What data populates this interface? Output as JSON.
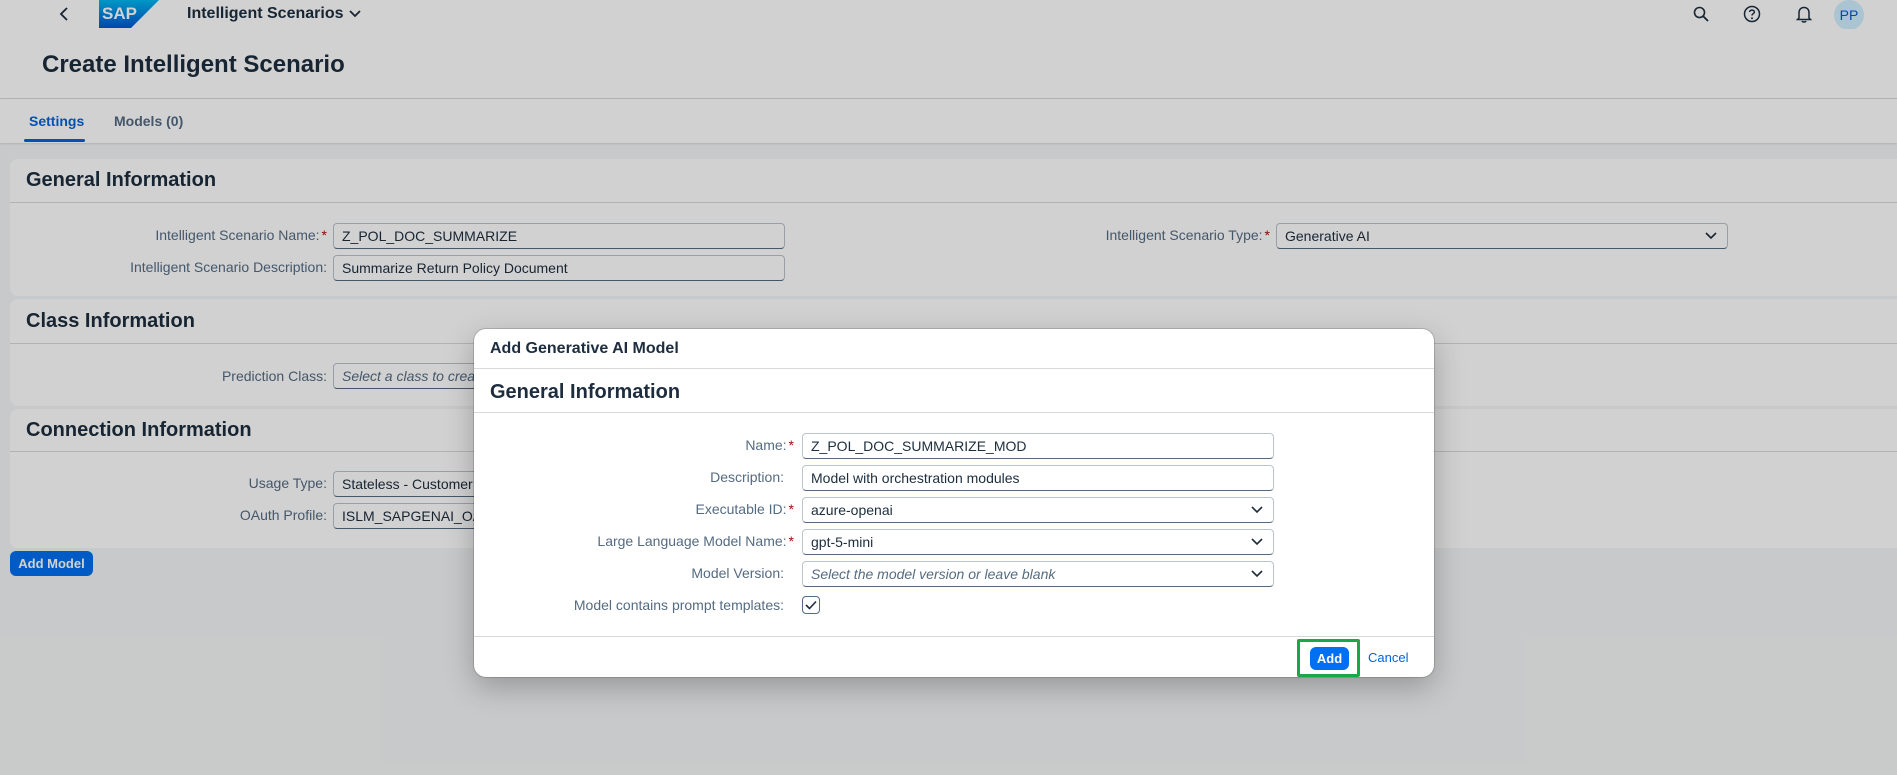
{
  "shell": {
    "logo_text": "SAP",
    "app_name": "Intelligent Scenarios",
    "avatar_initials": "PP"
  },
  "page": {
    "title": "Create Intelligent Scenario",
    "tabs": [
      {
        "label": "Settings"
      },
      {
        "label": "Models (0)"
      }
    ]
  },
  "general": {
    "heading": "General Information",
    "name_label": "Intelligent Scenario Name:",
    "name_value": "Z_POL_DOC_SUMMARIZE",
    "description_label": "Intelligent Scenario Description:",
    "description_value": "Summarize Return Policy Document",
    "type_label": "Intelligent Scenario Type:",
    "type_value": "Generative AI"
  },
  "class": {
    "heading": "Class Information",
    "prediction_label": "Prediction Class:",
    "prediction_placeholder": "Select a class to crea"
  },
  "connection": {
    "heading": "Connection Information",
    "usage_label": "Usage Type:",
    "usage_value": "Stateless - Customer",
    "oauth_label": "OAuth Profile:",
    "oauth_value": "ISLM_SAPGENAI_OA"
  },
  "add_model_label": "Add Model",
  "dialog": {
    "title": "Add Generative AI Model",
    "section": "General Information",
    "name_label": "Name:",
    "name_value": "Z_POL_DOC_SUMMARIZE_MOD",
    "description_label": "Description:",
    "description_value": "Model with orchestration modules",
    "exec_label": "Executable ID:",
    "exec_value": "azure-openai",
    "llm_label": "Large Language Model Name:",
    "llm_value": "gpt-5-mini",
    "version_label": "Model Version:",
    "version_placeholder": "Select the model version or leave blank",
    "prompt_label": "Model contains prompt templates:",
    "prompt_checked": true,
    "add_label": "Add",
    "cancel_label": "Cancel"
  },
  "colors": {
    "accent": "#0070f2",
    "link": "#0064d9",
    "required": "#aa0808",
    "focus_highlight": "#1aa74b"
  }
}
